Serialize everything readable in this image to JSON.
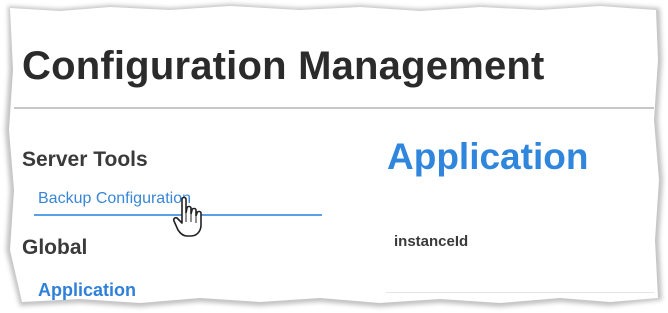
{
  "header": {
    "title": "Configuration Management"
  },
  "sidebar": {
    "sections": [
      {
        "heading": "Server Tools",
        "items": [
          {
            "label": "Backup Configuration"
          }
        ]
      },
      {
        "heading": "Global",
        "items": [
          {
            "label": "Application"
          }
        ]
      }
    ]
  },
  "main": {
    "title": "Application",
    "fields": [
      {
        "label": "instanceId"
      }
    ]
  },
  "colors": {
    "accent": "#2f86dc",
    "text": "#2b2b2b"
  },
  "icons": {
    "cursor": "hand-pointer-icon"
  }
}
